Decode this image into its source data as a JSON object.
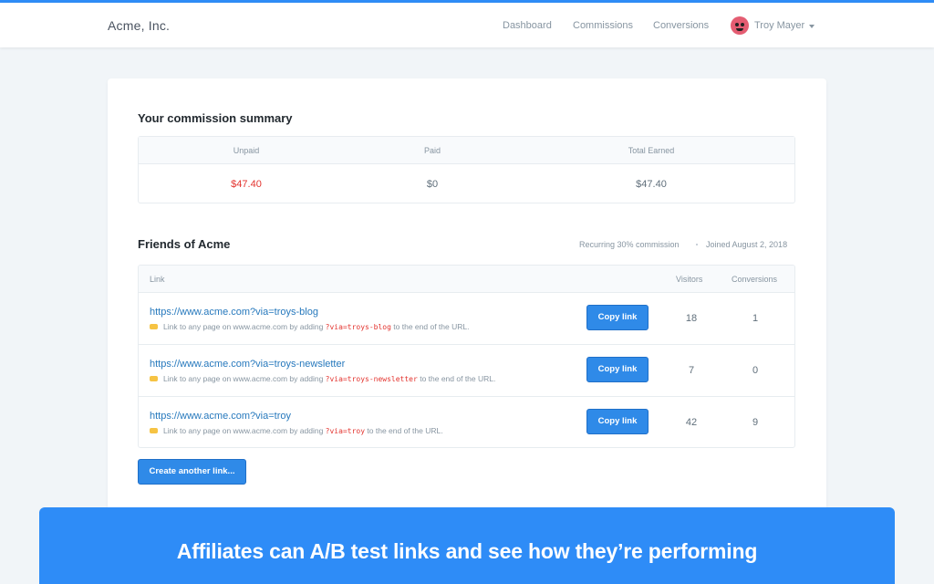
{
  "brand": "Acme, Inc.",
  "nav": {
    "items": [
      "Dashboard",
      "Commissions",
      "Conversions"
    ],
    "user_name": "Troy Mayer"
  },
  "summary": {
    "title": "Your commission summary",
    "headers": [
      "Unpaid",
      "Paid",
      "Total Earned"
    ],
    "values": [
      "$47.40",
      "$0",
      "$47.40"
    ],
    "unpaid_color": "#e3342f"
  },
  "program": {
    "title": "Friends of Acme",
    "commission": "Recurring 30% commission",
    "joined": "Joined August 2, 2018"
  },
  "links": {
    "headers": {
      "link": "Link",
      "visitors": "Visitors",
      "conversions": "Conversions"
    },
    "copy_label": "Copy link",
    "hint_prefix": "Link to any page on www.acme.com by adding",
    "hint_suffix": "to the end of the URL.",
    "rows": [
      {
        "url": "https://www.acme.com?via=troys-blog",
        "param": "?via=troys-blog",
        "visitors": "18",
        "conversions": "1"
      },
      {
        "url": "https://www.acme.com?via=troys-newsletter",
        "param": "?via=troys-newsletter",
        "visitors": "7",
        "conversions": "0"
      },
      {
        "url": "https://www.acme.com?via=troy",
        "param": "?via=troy",
        "visitors": "42",
        "conversions": "9"
      }
    ]
  },
  "create_label": "Create another link...",
  "banner": "Affiliates can A/B test links and see how they’re performing",
  "colors": {
    "accent": "#2e8cf7",
    "button": "#2f8ae8",
    "link": "#2779bd",
    "background": "#f1f5f8"
  }
}
